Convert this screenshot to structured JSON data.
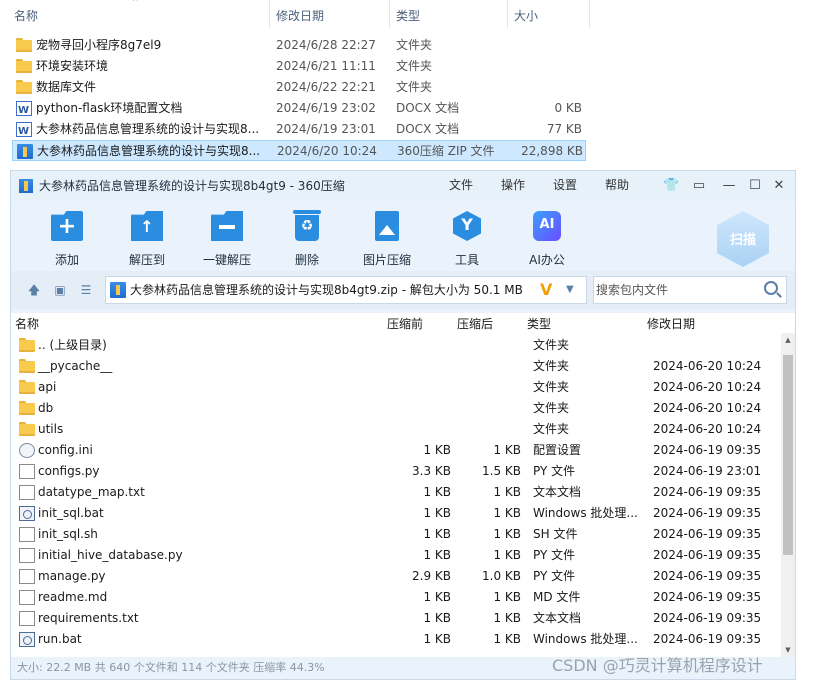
{
  "explorer": {
    "columns": [
      "名称",
      "修改日期",
      "类型",
      "大小"
    ],
    "rows": [
      {
        "icon": "folder-icon",
        "name": "宠物寻回小程序8g7el9",
        "date": "2024/6/28 22:27",
        "type": "文件夹",
        "size": ""
      },
      {
        "icon": "folder-icon",
        "name": "环境安装环境",
        "date": "2024/6/21 11:11",
        "type": "文件夹",
        "size": ""
      },
      {
        "icon": "folder-icon",
        "name": "数据库文件",
        "date": "2024/6/22 22:21",
        "type": "文件夹",
        "size": ""
      },
      {
        "icon": "docx-icon",
        "name": "python-flask环境配置文档",
        "date": "2024/6/19 23:02",
        "type": "DOCX 文档",
        "size": "0 KB"
      },
      {
        "icon": "docx-icon",
        "name": "大参林药品信息管理系统的设计与实现8...",
        "date": "2024/6/19 23:01",
        "type": "DOCX 文档",
        "size": "77 KB"
      },
      {
        "icon": "zip-icon",
        "name": "大参林药品信息管理系统的设计与实现8...",
        "date": "2024/6/20 10:24",
        "type": "360压缩 ZIP 文件",
        "size": "22,898 KB",
        "selected": true
      }
    ]
  },
  "zip": {
    "title": "大参林药品信息管理系统的设计与实现8b4gt9 - 360压缩",
    "menus": [
      "文件",
      "操作",
      "设置",
      "帮助"
    ],
    "tools": [
      {
        "label": "添加",
        "icon": "add-icon"
      },
      {
        "label": "解压到",
        "icon": "extract-icon"
      },
      {
        "label": "一键解压",
        "icon": "one-click-extract-icon"
      },
      {
        "label": "删除",
        "icon": "delete-icon"
      },
      {
        "label": "图片压缩",
        "icon": "image-compress-icon"
      },
      {
        "label": "工具",
        "icon": "tools-icon"
      },
      {
        "label": "AI办公",
        "icon": "ai-office-icon"
      }
    ],
    "scan_label": "扫描",
    "address": "大参林药品信息管理系统的设计与实现8b4gt9.zip - 解包大小为 50.1 MB",
    "search_placeholder": "搜索包内文件",
    "columns": [
      "名称",
      "压缩前",
      "压缩后",
      "类型",
      "修改日期"
    ],
    "rows": [
      {
        "icon": "folder-icon",
        "name": ".. (上级目录)",
        "csize": "",
        "size": "",
        "type": "文件夹",
        "date": ""
      },
      {
        "icon": "folder-icon",
        "name": "__pycache__",
        "csize": "",
        "size": "",
        "type": "文件夹",
        "date": "2024-06-20 10:24"
      },
      {
        "icon": "folder-icon",
        "name": "api",
        "csize": "",
        "size": "",
        "type": "文件夹",
        "date": "2024-06-20 10:24"
      },
      {
        "icon": "folder-icon",
        "name": "db",
        "csize": "",
        "size": "",
        "type": "文件夹",
        "date": "2024-06-20 10:24"
      },
      {
        "icon": "folder-icon",
        "name": "utils",
        "csize": "",
        "size": "",
        "type": "文件夹",
        "date": "2024-06-20 10:24"
      },
      {
        "icon": "config-icon",
        "name": "config.ini",
        "csize": "1 KB",
        "size": "1 KB",
        "type": "配置设置",
        "date": "2024-06-19 09:35"
      },
      {
        "icon": "file-icon",
        "name": "configs.py",
        "csize": "3.3 KB",
        "size": "1.5 KB",
        "type": "PY 文件",
        "date": "2024-06-19 23:01"
      },
      {
        "icon": "file-icon",
        "name": "datatype_map.txt",
        "csize": "1 KB",
        "size": "1 KB",
        "type": "文本文档",
        "date": "2024-06-19 09:35"
      },
      {
        "icon": "batch-icon",
        "name": "init_sql.bat",
        "csize": "1 KB",
        "size": "1 KB",
        "type": "Windows 批处理...",
        "date": "2024-06-19 09:35"
      },
      {
        "icon": "file-icon",
        "name": "init_sql.sh",
        "csize": "1 KB",
        "size": "1 KB",
        "type": "SH 文件",
        "date": "2024-06-19 09:35"
      },
      {
        "icon": "file-icon",
        "name": "initial_hive_database.py",
        "csize": "1 KB",
        "size": "1 KB",
        "type": "PY 文件",
        "date": "2024-06-19 09:35"
      },
      {
        "icon": "file-icon",
        "name": "manage.py",
        "csize": "2.9 KB",
        "size": "1.0 KB",
        "type": "PY 文件",
        "date": "2024-06-19 09:35"
      },
      {
        "icon": "file-icon",
        "name": "readme.md",
        "csize": "1 KB",
        "size": "1 KB",
        "type": "MD 文件",
        "date": "2024-06-19 09:35"
      },
      {
        "icon": "file-icon",
        "name": "requirements.txt",
        "csize": "1 KB",
        "size": "1 KB",
        "type": "文本文档",
        "date": "2024-06-19 09:35"
      },
      {
        "icon": "batch-icon",
        "name": "run.bat",
        "csize": "1 KB",
        "size": "1 KB",
        "type": "Windows 批处理...",
        "date": "2024-06-19 09:35"
      }
    ],
    "status": "大小: 22.2 MB 共 640 个文件和 114 个文件夹 压缩率 44.3%"
  },
  "watermark": "CSDN @巧灵计算机程序设计"
}
